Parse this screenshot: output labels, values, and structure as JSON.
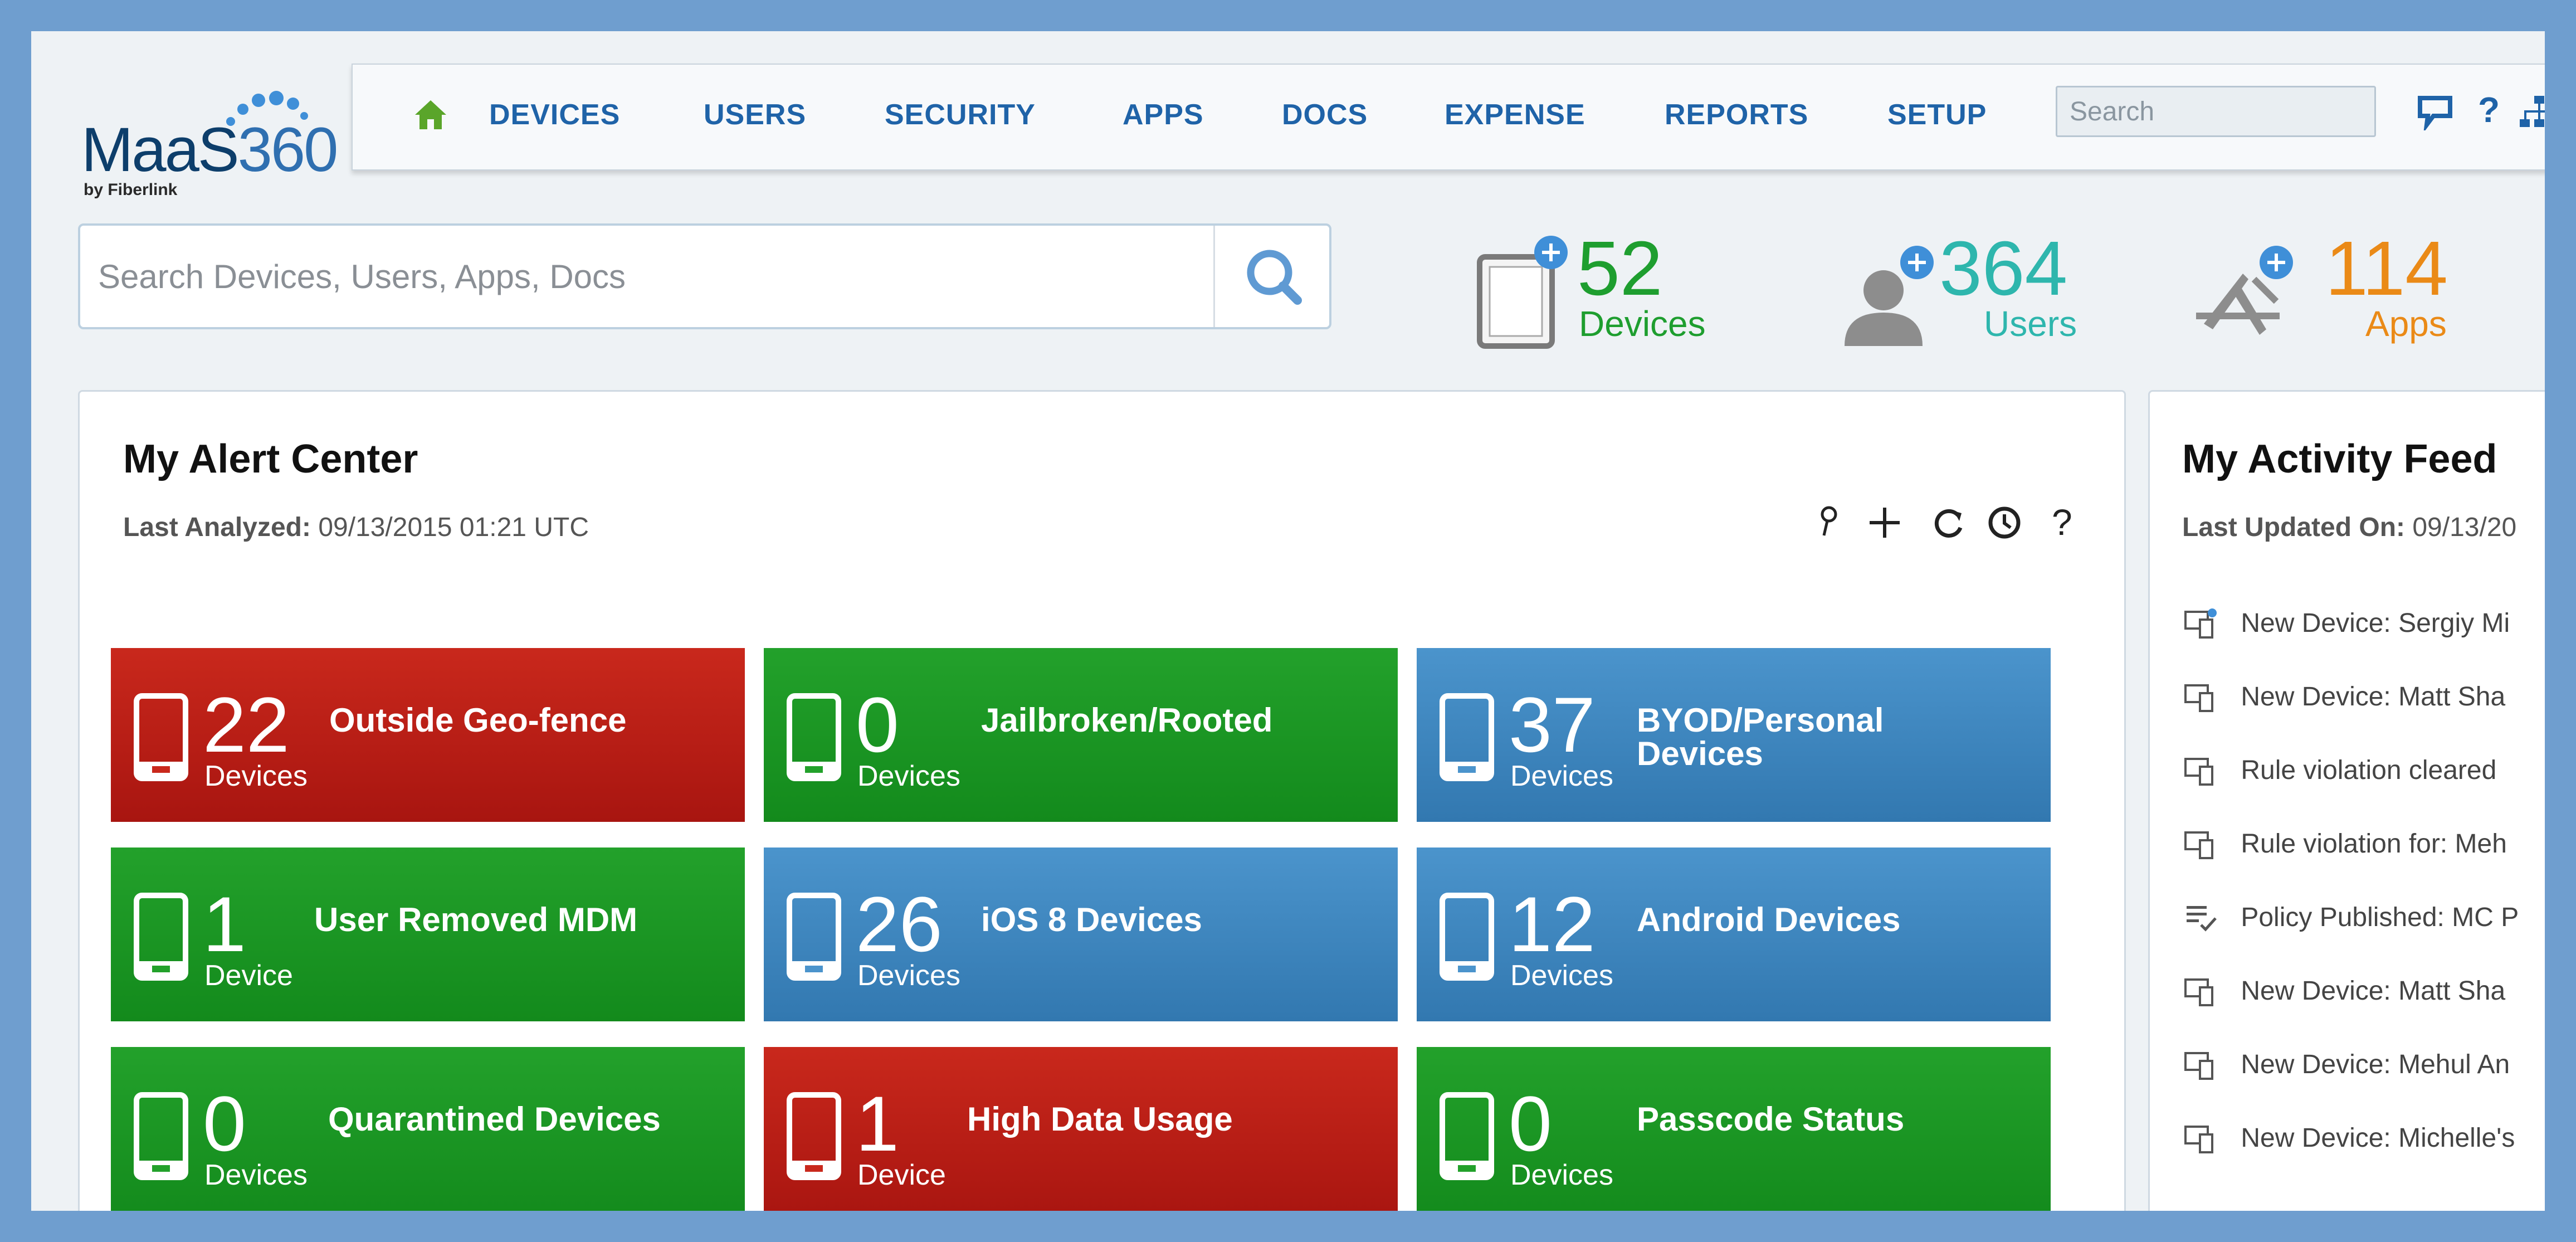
{
  "app": {
    "logo_text": "MaaS",
    "logo_num": "360",
    "logo_sub": "by Fiberlink"
  },
  "nav": {
    "items": [
      {
        "label": "DEVICES"
      },
      {
        "label": "USERS"
      },
      {
        "label": "SECURITY"
      },
      {
        "label": "APPS"
      },
      {
        "label": "DOCS"
      },
      {
        "label": "EXPENSE"
      },
      {
        "label": "REPORTS"
      },
      {
        "label": "SETUP"
      }
    ],
    "search_placeholder": "Search",
    "icons": [
      "home-icon",
      "chat-icon",
      "help-icon",
      "network-icon"
    ]
  },
  "search": {
    "placeholder": "Search Devices, Users, Apps, Docs"
  },
  "stats": [
    {
      "count": "52",
      "label": "Devices",
      "color": "#1e9e2f",
      "icon": "tablet-icon"
    },
    {
      "count": "364",
      "label": "Users",
      "color": "#2eb6ad",
      "icon": "user-icon"
    },
    {
      "count": "114",
      "label": "Apps",
      "color": "#ea8a17",
      "icon": "apps-icon"
    }
  ],
  "alert_center": {
    "title": "My Alert Center",
    "meta_label": "Last Analyzed:",
    "meta_value": "09/13/2015 01:21 UTC",
    "tools": [
      "pin-icon",
      "add-icon",
      "refresh-icon",
      "clock-icon",
      "help-icon"
    ],
    "tiles": [
      {
        "count": "22",
        "unit": "Devices",
        "title": "Outside Geo-fence",
        "color": "red"
      },
      {
        "count": "0",
        "unit": "Devices",
        "title": "Jailbroken/Rooted",
        "color": "green"
      },
      {
        "count": "37",
        "unit": "Devices",
        "title": "BYOD/Personal Devices",
        "color": "blue"
      },
      {
        "count": "1",
        "unit": "Device",
        "title": "User Removed MDM",
        "color": "green"
      },
      {
        "count": "26",
        "unit": "Devices",
        "title": "iOS 8 Devices",
        "color": "blue"
      },
      {
        "count": "12",
        "unit": "Devices",
        "title": "Android Devices",
        "color": "blue"
      },
      {
        "count": "0",
        "unit": "Devices",
        "title": "Quarantined Devices",
        "color": "green"
      },
      {
        "count": "1",
        "unit": "Device",
        "title": "High Data Usage",
        "color": "red"
      },
      {
        "count": "0",
        "unit": "Devices",
        "title": "Passcode Status",
        "color": "green"
      }
    ]
  },
  "activity_feed": {
    "title": "My Activity Feed",
    "meta_label": "Last Updated On:",
    "meta_value": "09/13/20",
    "items": [
      {
        "text": "New Device: Sergiy Mi",
        "icon": "new-device-icon"
      },
      {
        "text": "New Device: Matt Sha",
        "icon": "device-icon"
      },
      {
        "text": "Rule violation cleared",
        "icon": "device-icon"
      },
      {
        "text": "Rule violation for: Meh",
        "icon": "device-icon"
      },
      {
        "text": "Policy Published: MC P",
        "icon": "policy-icon"
      },
      {
        "text": "New Device: Matt Sha",
        "icon": "device-icon"
      },
      {
        "text": "New Device: Mehul An",
        "icon": "device-icon"
      },
      {
        "text": "New Device: Michelle's",
        "icon": "device-icon"
      }
    ]
  },
  "colors": {
    "frame": "#6f9ecf",
    "nav_text": "#1f63a8",
    "red": "#b81d15",
    "green": "#1b9524",
    "blue": "#3f87bf"
  }
}
